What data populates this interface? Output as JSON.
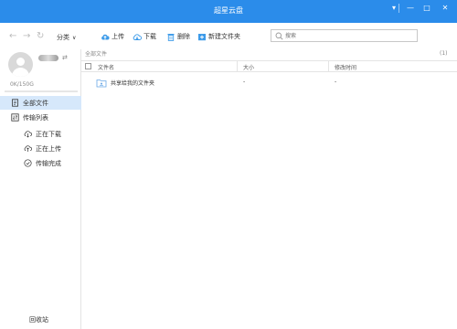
{
  "window": {
    "title": "超星云盘",
    "controls": [
      "menu-icon",
      "minimize-icon",
      "maximize-icon",
      "close-icon"
    ]
  },
  "toolbar": {
    "category_label": "分类",
    "upload_label": "上传",
    "download_label": "下载",
    "delete_label": "删除",
    "new_folder_label": "新建文件夹",
    "search_placeholder": "搜索"
  },
  "sidebar": {
    "storage_text": "0K/150G",
    "storage_used_fraction": 0.0,
    "items": [
      {
        "label": "全部文件",
        "icon": "document-icon",
        "selected": true
      },
      {
        "label": "传输列表",
        "icon": "transfer-icon"
      },
      {
        "label": "正在下载",
        "icon": "cloud-download-icon"
      },
      {
        "label": "正在上传",
        "icon": "cloud-upload-icon"
      },
      {
        "label": "传输完成",
        "icon": "check-circle-icon"
      }
    ],
    "recycle_label": "回收站"
  },
  "main": {
    "breadcrumb": "全部文件",
    "count": "(1)",
    "columns": [
      "文件名",
      "大小",
      "修改时间"
    ],
    "rows": [
      {
        "name": "共享给我的文件夹",
        "size": "-",
        "modified": "-",
        "icon": "shared-folder-icon"
      }
    ]
  },
  "colors": {
    "accent": "#2b8cea",
    "selected_bg": "#d6e8fb"
  }
}
